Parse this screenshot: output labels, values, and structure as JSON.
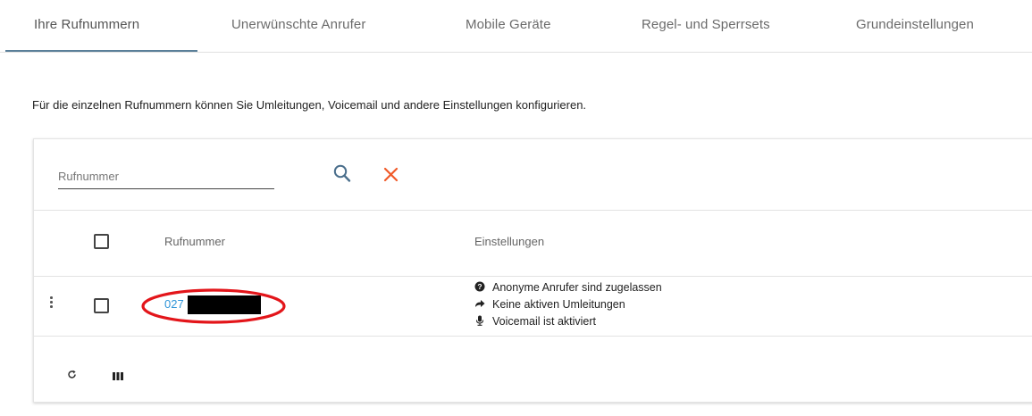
{
  "tabs": [
    {
      "label": "Ihre Rufnummern",
      "active": true
    },
    {
      "label": "Unerwünschte Anrufer",
      "active": false
    },
    {
      "label": "Mobile Geräte",
      "active": false
    },
    {
      "label": "Regel- und Sperrsets",
      "active": false
    },
    {
      "label": "Grundeinstellungen",
      "active": false
    }
  ],
  "description": "Für die einzelnen Rufnummern können Sie Umleitungen, Voicemail und andere Einstellungen konfigurieren.",
  "search": {
    "placeholder": "Rufnummer",
    "value": ""
  },
  "table": {
    "columns": [
      "Rufnummer",
      "Einstellungen"
    ],
    "rows": [
      {
        "number_visible": "027",
        "number_redacted": true,
        "settings": [
          {
            "icon": "question-circle-icon",
            "text": "Anonyme Anrufer sind zugelassen"
          },
          {
            "icon": "share-arrow-icon",
            "text": "Keine aktiven Umleitungen"
          },
          {
            "icon": "microphone-icon",
            "text": "Voicemail ist aktiviert"
          }
        ]
      }
    ]
  },
  "footer": {
    "icons": [
      "refresh-icon",
      "columns-icon"
    ]
  },
  "colors": {
    "accent": "#5a7f99",
    "link": "#2f95d8",
    "clear": "#f05a28",
    "annotation": "#e3151a"
  }
}
